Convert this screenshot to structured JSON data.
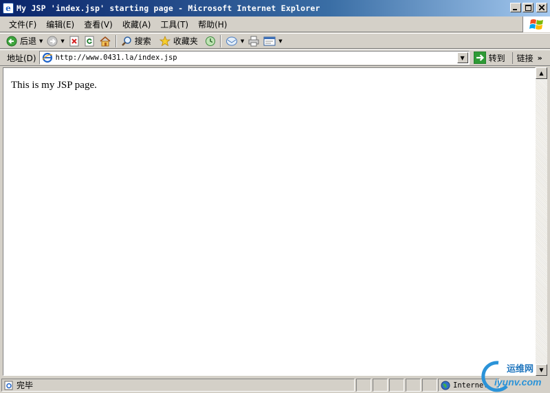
{
  "window": {
    "title": "My JSP 'index.jsp' starting page - Microsoft Internet Explorer",
    "controls": [
      "minimize",
      "maximize",
      "close"
    ]
  },
  "menu": {
    "items": [
      {
        "label": "文件(F)"
      },
      {
        "label": "编辑(E)"
      },
      {
        "label": "查看(V)"
      },
      {
        "label": "收藏(A)"
      },
      {
        "label": "工具(T)"
      },
      {
        "label": "帮助(H)"
      }
    ]
  },
  "toolbar": {
    "back_label": "后退",
    "search_label": "搜索",
    "favorites_label": "收藏夹",
    "icons": [
      "back-icon",
      "forward-icon",
      "stop-icon",
      "refresh-icon",
      "home-icon",
      "search-icon",
      "favorites-icon",
      "history-icon",
      "mail-icon",
      "print-icon",
      "edit-icon"
    ]
  },
  "address": {
    "label": "地址(D)",
    "url": "http://www.0431.la/index.jsp",
    "go_label": "转到",
    "links_label": "链接"
  },
  "page": {
    "body_text": "This is my JSP page."
  },
  "status": {
    "text": "完毕",
    "zone": "Internet"
  },
  "watermark": {
    "top": "运维网",
    "bottom": "iyunv.com"
  },
  "colors": {
    "titlebar_start": "#0a246a",
    "titlebar_end": "#a6caf0",
    "chrome": "#d4d0c8",
    "content_bg": "#ffffff",
    "go_green": "#2e9a36"
  }
}
